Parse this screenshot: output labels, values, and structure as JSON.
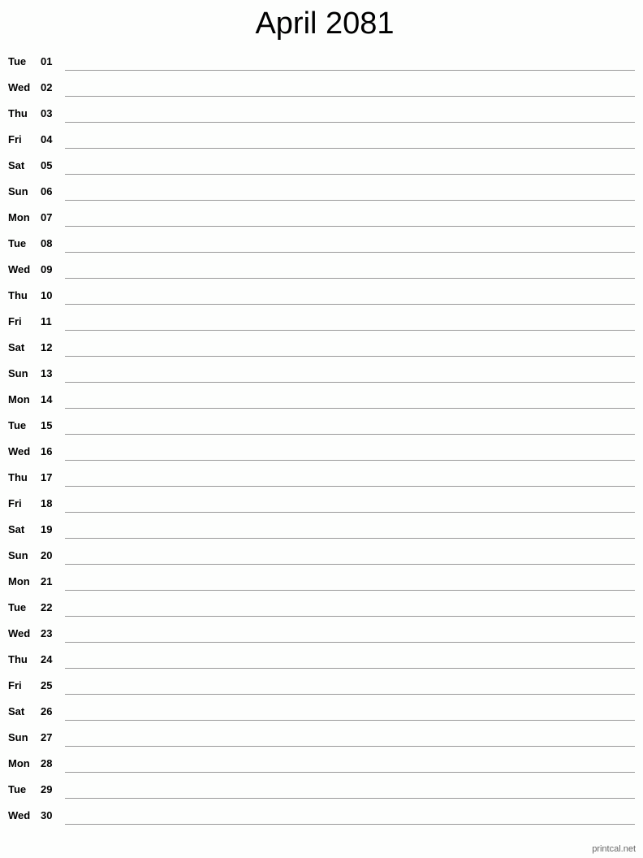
{
  "title": "April 2081",
  "days": [
    {
      "dow": "Tue",
      "day": "01"
    },
    {
      "dow": "Wed",
      "day": "02"
    },
    {
      "dow": "Thu",
      "day": "03"
    },
    {
      "dow": "Fri",
      "day": "04"
    },
    {
      "dow": "Sat",
      "day": "05"
    },
    {
      "dow": "Sun",
      "day": "06"
    },
    {
      "dow": "Mon",
      "day": "07"
    },
    {
      "dow": "Tue",
      "day": "08"
    },
    {
      "dow": "Wed",
      "day": "09"
    },
    {
      "dow": "Thu",
      "day": "10"
    },
    {
      "dow": "Fri",
      "day": "11"
    },
    {
      "dow": "Sat",
      "day": "12"
    },
    {
      "dow": "Sun",
      "day": "13"
    },
    {
      "dow": "Mon",
      "day": "14"
    },
    {
      "dow": "Tue",
      "day": "15"
    },
    {
      "dow": "Wed",
      "day": "16"
    },
    {
      "dow": "Thu",
      "day": "17"
    },
    {
      "dow": "Fri",
      "day": "18"
    },
    {
      "dow": "Sat",
      "day": "19"
    },
    {
      "dow": "Sun",
      "day": "20"
    },
    {
      "dow": "Mon",
      "day": "21"
    },
    {
      "dow": "Tue",
      "day": "22"
    },
    {
      "dow": "Wed",
      "day": "23"
    },
    {
      "dow": "Thu",
      "day": "24"
    },
    {
      "dow": "Fri",
      "day": "25"
    },
    {
      "dow": "Sat",
      "day": "26"
    },
    {
      "dow": "Sun",
      "day": "27"
    },
    {
      "dow": "Mon",
      "day": "28"
    },
    {
      "dow": "Tue",
      "day": "29"
    },
    {
      "dow": "Wed",
      "day": "30"
    }
  ],
  "footer": "printcal.net"
}
